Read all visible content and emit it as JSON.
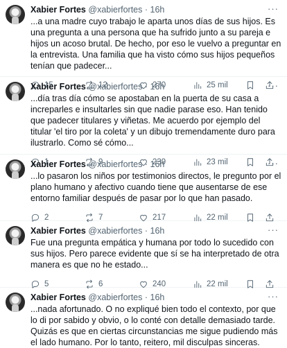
{
  "tweets": [
    {
      "name": "Xabier Fortes",
      "handle": "@xabierfortes",
      "sep": "·",
      "time": "16h",
      "more": "···",
      "text": "...a una madre cuyo trabajo le aparta unos días de sus hijos. Es una pregunta a una persona que ha sufrido junto a su pareja e hijos un acoso brutal. De hecho, por eso le vuelvo a preguntar en la entrevista. Una familia que ha visto cómo sus hijos pequeños tenían que padecer...",
      "replies": "15",
      "reposts": "12",
      "likes": "270",
      "views": "25 mil"
    },
    {
      "name": "Xabier Fortes",
      "handle": "@xabierfortes",
      "sep": "·",
      "time": "16h",
      "more": "···",
      "text": "...día tras día cómo se apostaban en la puerta de su casa a increparles e insultarles sin que nadie parase eso. Han tenido que padecer titulares y viñetas. Me acuerdo por ejemplo del titular 'el tiro por la coleta' y un dibujo tremendamente duro para ilustrarlo. Como sé cómo...",
      "replies": "1",
      "reposts": "9",
      "likes": "239",
      "views": "23 mil"
    },
    {
      "name": "Xabier Fortes",
      "handle": "@xabierfortes",
      "sep": "·",
      "time": "16h",
      "more": "···",
      "text": "...lo pasaron los niños por testimonios directos, le pregunto por el plano humano y afectivo cuando tiene que ausentarse de ese entorno familiar después de pasar por lo que han pasado.",
      "replies": "2",
      "reposts": "7",
      "likes": "217",
      "views": "22 mil"
    },
    {
      "name": "Xabier Fortes",
      "handle": "@xabierfortes",
      "sep": "·",
      "time": "16h",
      "more": "···",
      "text": "Fue una pregunta empática y humana por todo lo sucedido con sus hijos. Pero parece evidente que sí se ha interpretado de otra manera es que no he estado...",
      "replies": "5",
      "reposts": "6",
      "likes": "240",
      "views": "22 mil"
    },
    {
      "name": "Xabier Fortes",
      "handle": "@xabierfortes",
      "sep": "·",
      "time": "16h",
      "more": "···",
      "text": "...nada afortunado. O no expliqué bien todo el contexto, por que lo di por sabido y obvio, o lo conté con detalle demasiado tarde. Quizás es que en ciertas circunstancias me sigue pudiendo más el lado humano. Por lo tanto, reitero, mil disculpas sinceras."
    }
  ]
}
